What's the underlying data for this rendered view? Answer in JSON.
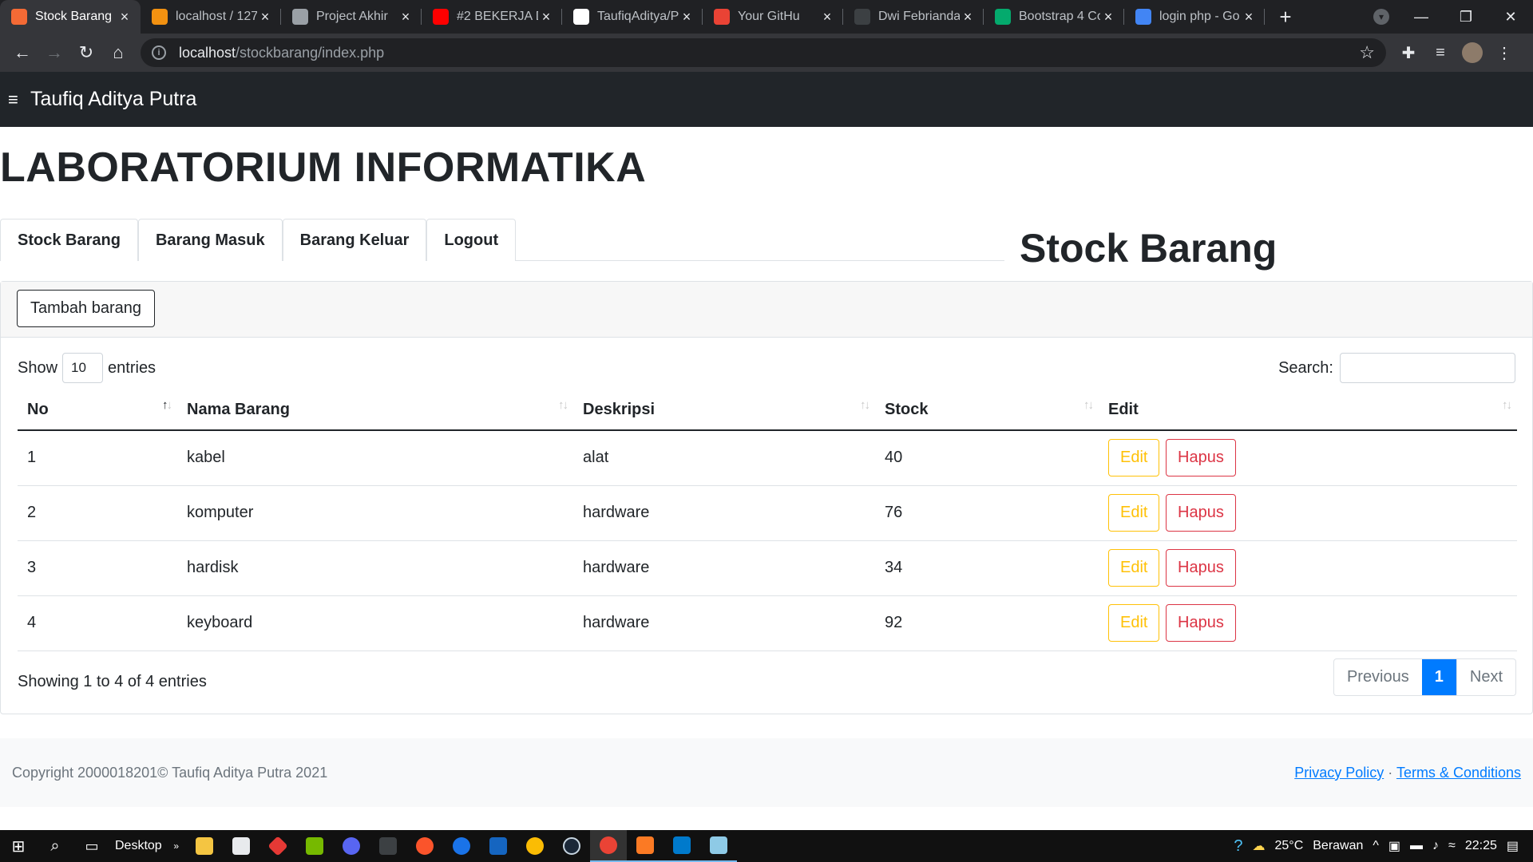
{
  "browser": {
    "tabs": [
      {
        "title": "Stock Barang",
        "favicon_color": "#f46a35",
        "active": true
      },
      {
        "title": "localhost / 127",
        "favicon_color": "#f29111",
        "active": false
      },
      {
        "title": "Project Akhir",
        "favicon_color": "#9aa0a6",
        "active": false
      },
      {
        "title": "#2 BEKERJA D",
        "favicon_color": "#ff0000",
        "active": false
      },
      {
        "title": "TaufiqAditya/P",
        "favicon_color": "#ffffff",
        "active": false
      },
      {
        "title": "Your GitHu",
        "favicon_color": "#ea4335",
        "active": false
      },
      {
        "title": "Dwi Febrianda",
        "favicon_color": "#3c4043",
        "active": false
      },
      {
        "title": "Bootstrap 4 Co",
        "favicon_color": "#04aa6d",
        "active": false
      },
      {
        "title": "login php - Go",
        "favicon_color": "#4285f4",
        "active": false
      }
    ],
    "address": {
      "host": "localhost",
      "path": "/stockbarang/index.php"
    }
  },
  "navbar": {
    "brand": "Taufiq Aditya Putra"
  },
  "page": {
    "heading": "LABORATORIUM INFORMATIKA",
    "tabs": [
      "Stock Barang",
      "Barang Masuk",
      "Barang Keluar",
      "Logout"
    ],
    "section_title": "Stock Barang",
    "add_button": "Tambah barang"
  },
  "datatable": {
    "show_label": "Show",
    "entries_value": "10",
    "entries_label": "entries",
    "search_label": "Search:",
    "search_value": "",
    "columns": [
      "No",
      "Nama Barang",
      "Deskripsi",
      "Stock",
      "Edit"
    ],
    "rows": [
      {
        "no": "1",
        "nama": "kabel",
        "deskripsi": "alat",
        "stock": "40"
      },
      {
        "no": "2",
        "nama": "komputer",
        "deskripsi": "hardware",
        "stock": "76"
      },
      {
        "no": "3",
        "nama": "hardisk",
        "deskripsi": "hardware",
        "stock": "34"
      },
      {
        "no": "4",
        "nama": "keyboard",
        "deskripsi": "hardware",
        "stock": "92"
      }
    ],
    "edit_label": "Edit",
    "delete_label": "Hapus",
    "info": "Showing 1 to 4 of 4 entries",
    "pagination": {
      "previous": "Previous",
      "current": "1",
      "next": "Next"
    }
  },
  "footer": {
    "copyright": "Copyright 2000018201© Taufiq Aditya Putra 2021",
    "privacy": "Privacy Policy",
    "separator": "·",
    "terms": "Terms & Conditions"
  },
  "taskbar": {
    "desktop_label": "Desktop",
    "weather": "25°C",
    "weather_desc": "Berawan",
    "time": "22:25"
  }
}
